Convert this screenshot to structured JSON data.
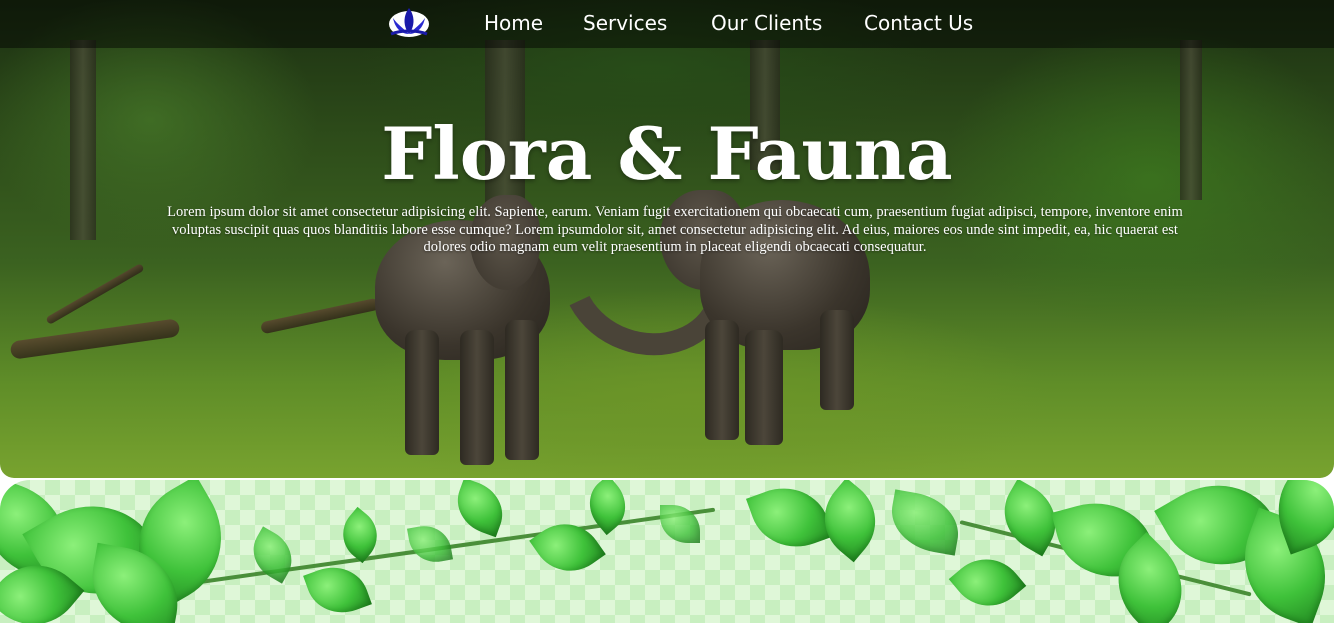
{
  "nav": {
    "logo_icon": "lotus-logo-icon",
    "items": [
      {
        "label": "Home"
      },
      {
        "label": "Services"
      },
      {
        "label": "Our Clients"
      },
      {
        "label": "Contact Us"
      }
    ]
  },
  "hero": {
    "title": "Flora & Fauna",
    "text": "Lorem ipsum dolor sit amet consectetur adipisicing elit. Sapiente, earum. Veniam fugit exercitationem qui obcaecati cum, praesentium fugiat adipisci, tempore, inventore enim voluptas suscipit quas quos blanditiis labore esse cumque? Lorem ipsumdolor sit, amet consectetur adipisicing elit. Ad eius, maiores eos unde sint impedit, ea, hic quaerat est dolores odio magnam eum velit praesentium in placeat eligendi obcaecati consequatur.",
    "image": "forest-elephants-image"
  },
  "decor": {
    "band_image": "green-leaves-vine-image"
  },
  "colors": {
    "nav_bg": "#000000",
    "text": "#ffffff",
    "leaf_green": "#3fc23a"
  }
}
